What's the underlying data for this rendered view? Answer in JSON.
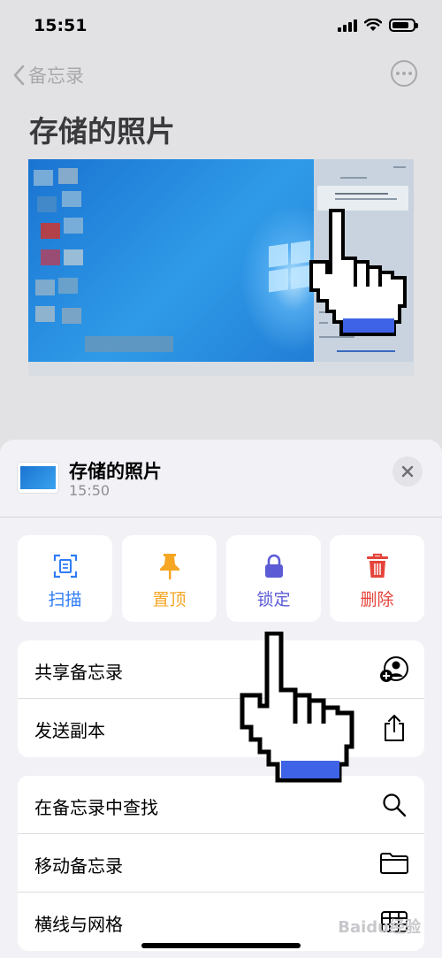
{
  "status_bar": {
    "time": "15:51"
  },
  "nav": {
    "back_label": "备忘录"
  },
  "note": {
    "title": "存储的照片"
  },
  "sheet": {
    "title": "存储的照片",
    "time": "15:50",
    "actions": [
      {
        "label": "扫描",
        "icon": "scan-icon",
        "color": "#2f7cf6"
      },
      {
        "label": "置顶",
        "icon": "pin-icon",
        "color": "#f5a623"
      },
      {
        "label": "锁定",
        "icon": "lock-icon",
        "color": "#5b5bd6"
      },
      {
        "label": "删除",
        "icon": "trash-icon",
        "color": "#e5443a"
      }
    ],
    "group1": [
      {
        "label": "共享备忘录",
        "icon": "share-person-icon"
      },
      {
        "label": "发送副本",
        "icon": "share-icon"
      }
    ],
    "group2": [
      {
        "label": "在备忘录中查找",
        "icon": "search-icon"
      },
      {
        "label": "移动备忘录",
        "icon": "folder-icon"
      },
      {
        "label": "横线与网格",
        "icon": "grid-icon"
      }
    ]
  },
  "watermark": "Baidu经验",
  "colors": {
    "sheet_bg": "#f2f2f6",
    "background": "#e2e2e4",
    "cursor_accent": "#3f63e6"
  }
}
